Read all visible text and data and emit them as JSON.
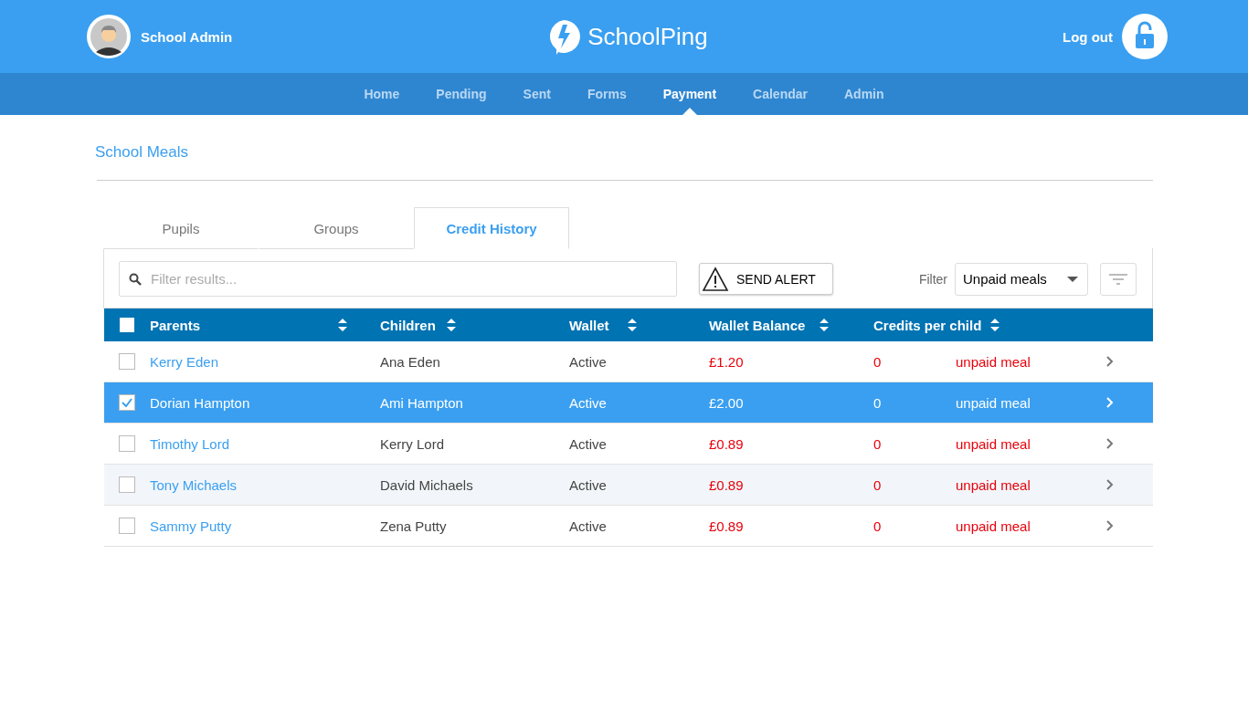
{
  "header": {
    "user_name": "School Admin",
    "logo_text": "SchoolPing",
    "logout_label": "Log out"
  },
  "nav": [
    {
      "label": "Home",
      "selected": false
    },
    {
      "label": "Pending",
      "selected": false
    },
    {
      "label": "Sent",
      "selected": false
    },
    {
      "label": "Forms",
      "selected": false
    },
    {
      "label": "Payment",
      "selected": true
    },
    {
      "label": "Calendar",
      "selected": false
    },
    {
      "label": "Admin",
      "selected": false
    }
  ],
  "page_title": "School Meals",
  "tabs": [
    {
      "label": "Pupils",
      "selected": false
    },
    {
      "label": "Groups",
      "selected": false
    },
    {
      "label": "Credit History",
      "selected": true
    }
  ],
  "toolbar": {
    "search_placeholder": "Filter results...",
    "alert_button": "SEND ALERT",
    "filter_label": "Filter",
    "filter_value": "Unpaid meals"
  },
  "table": {
    "select_all_checked": false,
    "columns": [
      "Parents",
      "Children",
      "Wallet",
      "Wallet Balance",
      "Credits per child"
    ],
    "rows": [
      {
        "parent": "Kerry Eden",
        "child": "Ana Eden",
        "wallet": "Active",
        "balance": "£1.20",
        "credits": "0",
        "status": "unpaid meal",
        "selected": false,
        "highlighted": false
      },
      {
        "parent": "Dorian Hampton",
        "child": "Ami Hampton",
        "wallet": "Active",
        "balance": "£2.00",
        "credits": "0",
        "status": "unpaid meal",
        "selected": true,
        "highlighted": false
      },
      {
        "parent": "Timothy Lord",
        "child": "Kerry Lord",
        "wallet": "Active",
        "balance": "£0.89",
        "credits": "0",
        "status": "unpaid meal",
        "selected": false,
        "highlighted": false
      },
      {
        "parent": "Tony Michaels",
        "child": "David Michaels",
        "wallet": "Active",
        "balance": "£0.89",
        "credits": "0",
        "status": "unpaid meal",
        "selected": false,
        "highlighted": true
      },
      {
        "parent": "Sammy Putty",
        "child": "Zena Putty",
        "wallet": "Active",
        "balance": "£0.89",
        "credits": "0",
        "status": "unpaid meal",
        "selected": false,
        "highlighted": false
      }
    ]
  }
}
